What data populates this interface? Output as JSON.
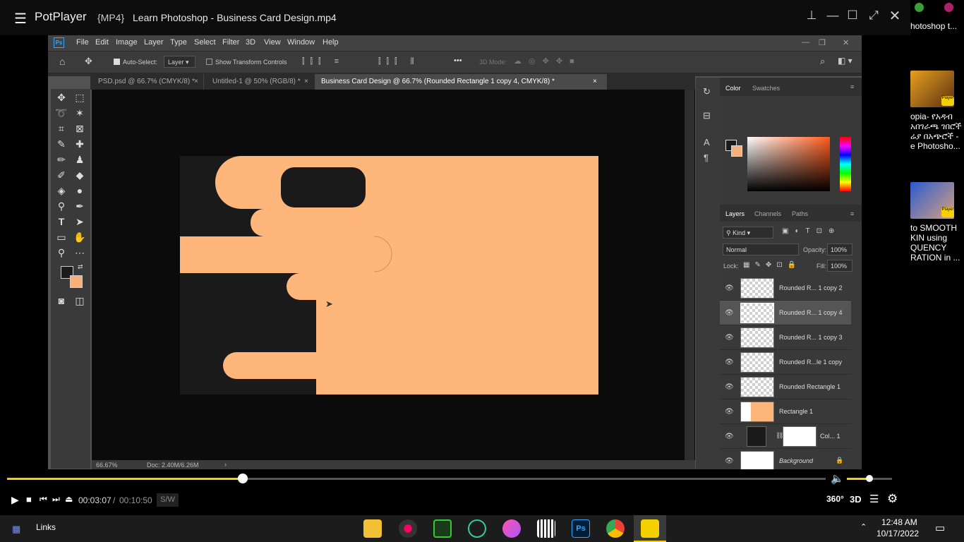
{
  "player": {
    "app": "PotPlayer",
    "format": "{MP4}",
    "file": "Learn Photoshop - Business Card Design.mp4",
    "current_time": "00:03:07",
    "separator": "/",
    "total_time": "00:10:50",
    "sw": "S/W",
    "progress": 0.288,
    "volume": 0.5,
    "btn_360": "360°",
    "btn_3d": "3D"
  },
  "sidebar": {
    "items": [
      {
        "title": "hotoshop t..."
      },
      {
        "title_lines": [
          "opia-  የአዳብ",
          "አበገራጫ ገበሮች",
          "ሬያ በአጭሮች -",
          "e Photosho..."
        ]
      },
      {
        "title_lines": [
          "to SMOOTH",
          "KIN using",
          "QUENCY",
          "RATION in ..."
        ]
      }
    ],
    "badge": "Player"
  },
  "ps": {
    "menu": [
      "File",
      "Edit",
      "Image",
      "Layer",
      "Type",
      "Select",
      "Filter",
      "3D",
      "View",
      "Window",
      "Help"
    ],
    "ps_logo": "Ps",
    "options": {
      "auto_select": "Auto-Select:",
      "layer_select": "Layer",
      "show_transform": "Show Transform Controls",
      "mode_3d": "3D Mode:",
      "more": "•••"
    },
    "tabs": [
      {
        "label": "PSD.psd @ 66.7% (CMYK/8) *"
      },
      {
        "label": "Untitled-1 @ 50% (RGB/8) *"
      },
      {
        "label": "Business Card Design @ 66.7% (Rounded Rectangle 1 copy 4, CMYK/8) *"
      }
    ],
    "close": "×",
    "status": {
      "zoom": "66.67%",
      "doc": "Doc: 2.40M/6.26M",
      "arrow": "›"
    },
    "color_panel": {
      "tabs": [
        "Color",
        "Swatches"
      ],
      "fg": "#1b1b1b",
      "bg": "#f8b07a"
    },
    "layers_panel": {
      "tabs": [
        "Layers",
        "Channels",
        "Paths"
      ],
      "kind": "Kind",
      "blend": "Normal",
      "opacity_label": "Opacity:",
      "opacity": "100%",
      "lock_label": "Lock:",
      "fill_label": "Fill:",
      "fill": "100%",
      "layers": [
        {
          "name": "Rounded R... 1 copy 2"
        },
        {
          "name": "Rounded R... 1 copy 4",
          "selected": true
        },
        {
          "name": "Rounded R... 1 copy 3"
        },
        {
          "name": "Rounded R...le 1 copy"
        },
        {
          "name": "Rounded Rectangle 1"
        },
        {
          "name": "Rectangle 1"
        },
        {
          "name": "Col... 1"
        },
        {
          "name": "Background"
        }
      ]
    },
    "art": {
      "dark": "#1a1a1a",
      "peach": "#ffb67a"
    }
  },
  "taskbar": {
    "links": "Links",
    "time": "12:48 AM",
    "date": "10/17/2022"
  }
}
